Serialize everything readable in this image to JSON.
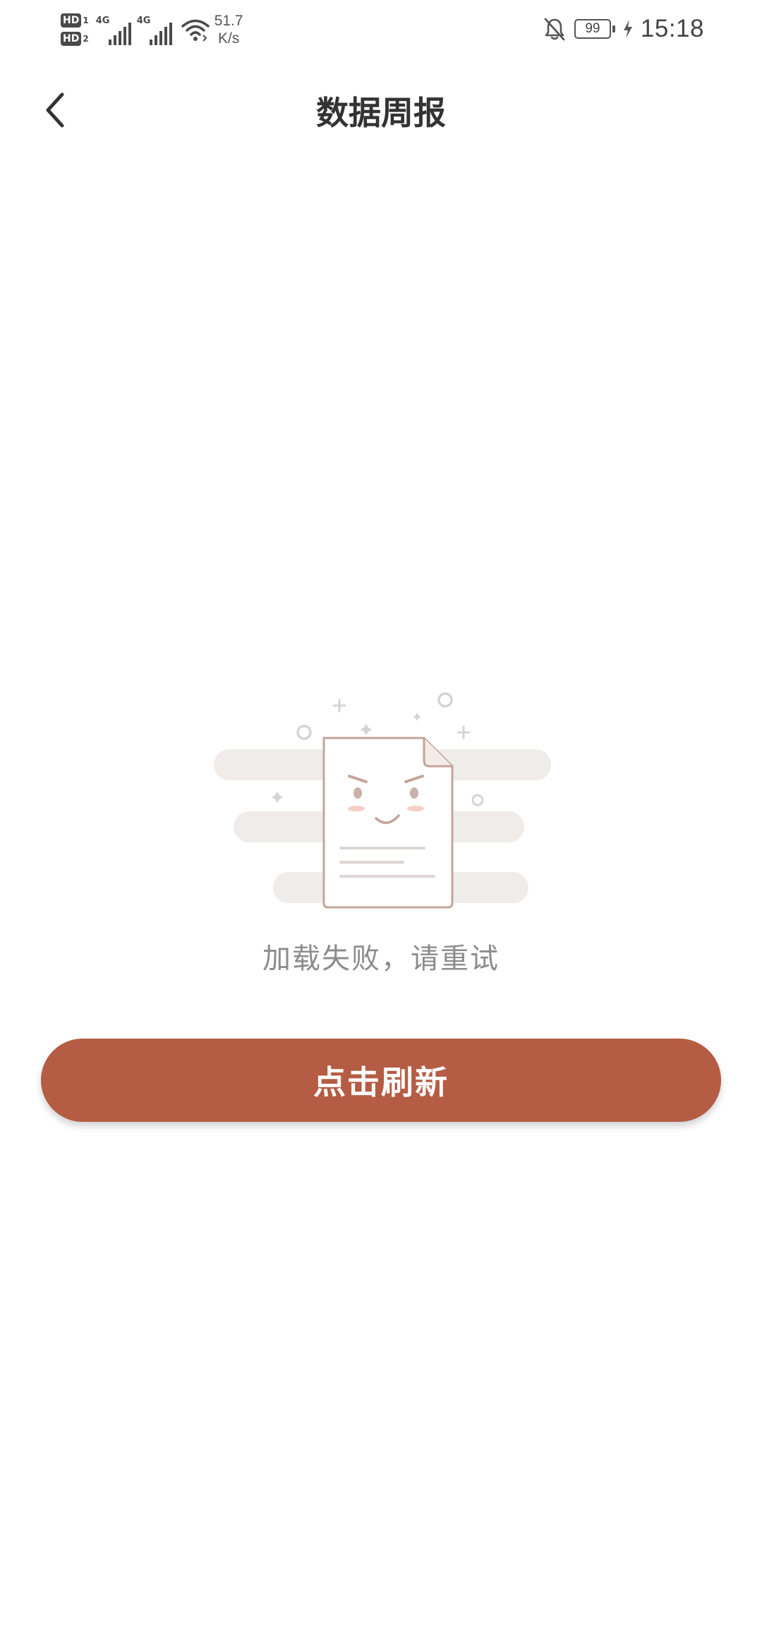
{
  "status_bar": {
    "hd1": "HD",
    "hd1_sim": "1",
    "hd2": "HD",
    "hd2_sim": "2",
    "net1": "4G",
    "net2": "4G",
    "speed_value": "51.7",
    "speed_unit": "K/s",
    "battery": "99",
    "time": "15:18",
    "icons": [
      "signal-icon",
      "wifi-icon",
      "bell-off-icon",
      "battery-icon",
      "charging-icon"
    ]
  },
  "header": {
    "title": "数据周报",
    "back_icon": "chevron-left-icon"
  },
  "empty_state": {
    "illustration": "sad-document-illustration",
    "message": "加载失败，请重试"
  },
  "actions": {
    "refresh_label": "点击刷新"
  },
  "colors": {
    "accent": "#b55c44",
    "title": "#333333",
    "message": "#8c8c8c"
  }
}
